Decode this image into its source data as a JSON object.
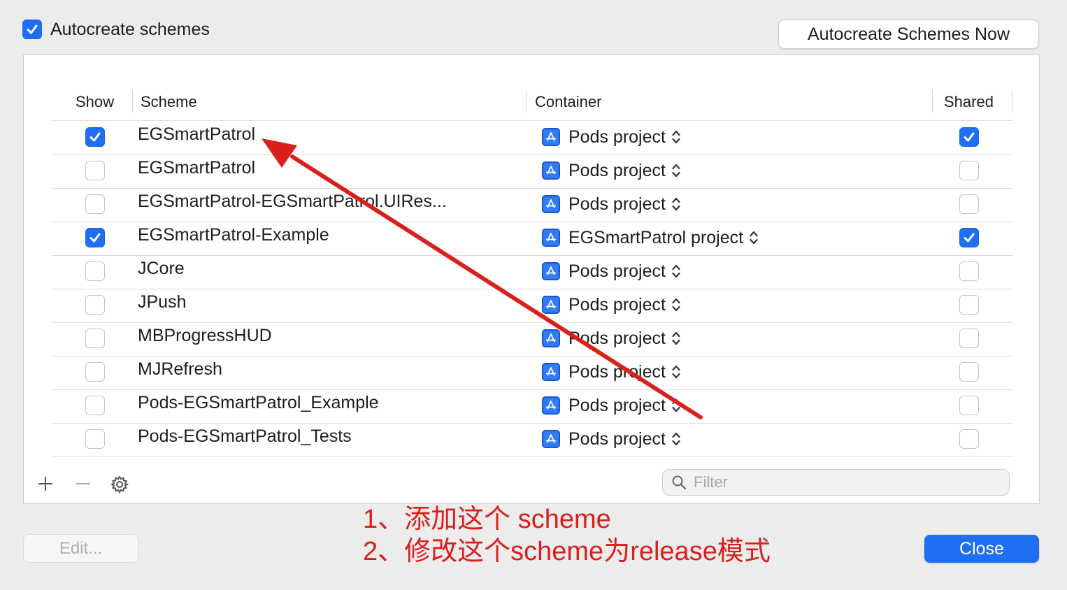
{
  "autocreate": {
    "label": "Autocreate schemes",
    "checked": true
  },
  "autocreate_now_label": "Autocreate Schemes Now",
  "columns": {
    "show": "Show",
    "scheme": "Scheme",
    "container": "Container",
    "shared": "Shared"
  },
  "rows": [
    {
      "show": true,
      "scheme": "EGSmartPatrol",
      "container": "Pods project",
      "shared": true
    },
    {
      "show": false,
      "scheme": "EGSmartPatrol",
      "container": "Pods project",
      "shared": false
    },
    {
      "show": false,
      "scheme": "EGSmartPatrol-EGSmartPatrol.UIRes...",
      "container": "Pods project",
      "shared": false
    },
    {
      "show": true,
      "scheme": "EGSmartPatrol-Example",
      "container": "EGSmartPatrol project",
      "shared": true
    },
    {
      "show": false,
      "scheme": "JCore",
      "container": "Pods project",
      "shared": false
    },
    {
      "show": false,
      "scheme": "JPush",
      "container": "Pods project",
      "shared": false
    },
    {
      "show": false,
      "scheme": "MBProgressHUD",
      "container": "Pods project",
      "shared": false
    },
    {
      "show": false,
      "scheme": "MJRefresh",
      "container": "Pods project",
      "shared": false
    },
    {
      "show": false,
      "scheme": "Pods-EGSmartPatrol_Example",
      "container": "Pods project",
      "shared": false
    },
    {
      "show": false,
      "scheme": "Pods-EGSmartPatrol_Tests",
      "container": "Pods project",
      "shared": false
    }
  ],
  "filter": {
    "placeholder": "Filter",
    "value": ""
  },
  "edit_label": "Edit...",
  "close_label": "Close",
  "annotation": {
    "line1": "1、添加这个 scheme",
    "line2": "2、修改这个scheme为release模式",
    "color": "#d9201c"
  },
  "colors": {
    "accent": "#1f6ff5",
    "annotation_red": "#d9201c"
  }
}
